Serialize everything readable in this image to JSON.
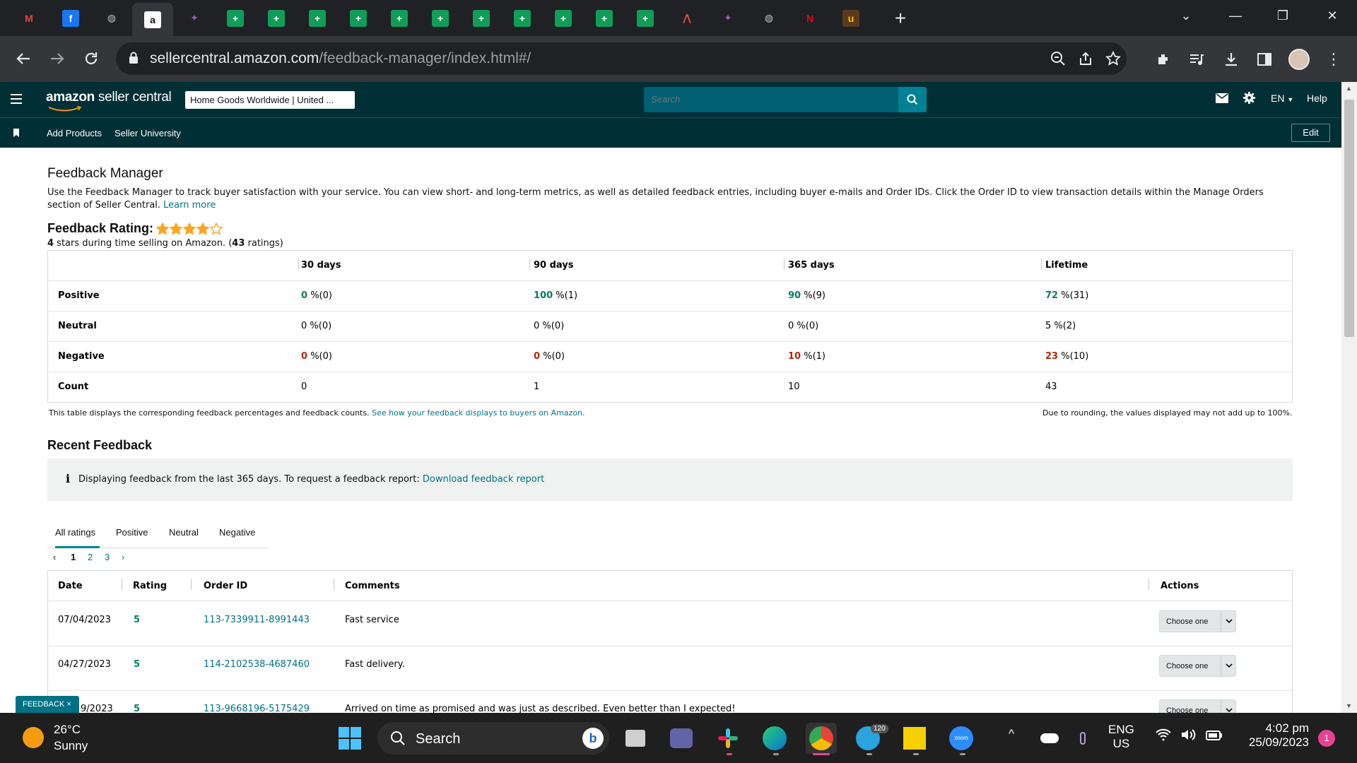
{
  "browser": {
    "url_host": "sellercentral.amazon.com",
    "url_path": "/feedback-manager/index.html#/",
    "tab_icons": [
      "gmail",
      "facebook",
      "globe",
      "amazon",
      "app",
      "sheets",
      "sheets",
      "sheets",
      "sheets",
      "sheets",
      "sheets",
      "sheets",
      "sheets",
      "sheets",
      "sheets",
      "sheets",
      "chart",
      "app",
      "globe",
      "netflix",
      "ups"
    ],
    "new_tab_label": "+"
  },
  "sc": {
    "logo_brand": "amazon",
    "logo_product": " seller central",
    "store": "Home Goods Worldwide | United ...",
    "search_placeholder": "Search",
    "language": "EN",
    "help": "Help",
    "nav_links": [
      "Add Products",
      "Seller University"
    ],
    "edit": "Edit"
  },
  "page": {
    "title": "Feedback Manager",
    "intro": "Use the Feedback Manager to track buyer satisfaction with your service. You can view short- and long-term metrics, as well as detailed feedback entries, including buyer e-mails and Order IDs. Click the Order ID to view transaction details within the Manage Orders section of Seller Central.",
    "learn_more": "Learn more",
    "rating_label": "Feedback Rating:",
    "rating_stars": 4,
    "rating_max": 5,
    "rating_value": "4",
    "rating_text_mid": " stars during time selling on Amazon. (",
    "rating_count": "43",
    "rating_text_end": " ratings)"
  },
  "metrics": {
    "headers": [
      "30 days",
      "90 days",
      "365 days",
      "Lifetime"
    ],
    "rows": [
      {
        "label": "Positive",
        "cells": [
          [
            "0",
            "%(0)"
          ],
          [
            "100",
            "%(1)"
          ],
          [
            "90",
            "%(9)"
          ],
          [
            "72",
            "%(31)"
          ]
        ],
        "tone": "green"
      },
      {
        "label": "Neutral",
        "cells": [
          [
            "0",
            "%(0)"
          ],
          [
            "0",
            "%(0)"
          ],
          [
            "0",
            "%(0)"
          ],
          [
            "5",
            "%(2)"
          ]
        ],
        "tone": "plain"
      },
      {
        "label": "Negative",
        "cells": [
          [
            "0",
            "%(0)"
          ],
          [
            "0",
            "%(0)"
          ],
          [
            "10",
            "%(1)"
          ],
          [
            "23",
            "%(10)"
          ]
        ],
        "tone": "red"
      },
      {
        "label": "Count",
        "cells": [
          [
            "0",
            ""
          ],
          [
            "1",
            ""
          ],
          [
            "10",
            ""
          ],
          [
            "43",
            ""
          ]
        ],
        "tone": "plain"
      }
    ],
    "note_left": "This table displays the corresponding feedback percentages and feedback counts.",
    "note_link": "See how your feedback displays to buyers on Amazon.",
    "note_right": "Due to rounding, the values displayed may not add up to 100%."
  },
  "recent": {
    "title": "Recent Feedback",
    "info_icon": "i",
    "info_text": "Displaying feedback from the last 365 days. To request a feedback report:",
    "info_link": "Download feedback report",
    "tabs": [
      "All ratings",
      "Positive",
      "Neutral",
      "Negative"
    ],
    "pages": [
      "1",
      "2",
      "3"
    ],
    "columns": [
      "Date",
      "Rating",
      "Order ID",
      "Comments",
      "Actions"
    ],
    "rows": [
      {
        "date": "07/04/2023",
        "rating": "5",
        "order": "113-7339911-8991443",
        "comment": "Fast service",
        "action": "Choose one"
      },
      {
        "date": "04/27/2023",
        "rating": "5",
        "order": "114-2102538-4687460",
        "comment": "Fast delivery.",
        "action": "Choose one"
      },
      {
        "date": "9/2023",
        "rating": "5",
        "order": "113-9668196-5175429",
        "comment": "Arrived on time as promised and was just as described. Even better than I expected!",
        "action": "Choose one"
      }
    ],
    "feedback_tag": "FEEDBACK ×"
  },
  "taskbar": {
    "temp": "26°C",
    "weather": "Sunny",
    "search": "Search",
    "telegram_badge": "120",
    "lang_top": "ENG",
    "lang_bottom": "US",
    "time": "4:02 pm",
    "date": "25/09/2023",
    "notif_count": "1"
  },
  "colors": {
    "sc_header": "#002f36",
    "link": "#007185",
    "positive": "#067d62",
    "negative": "#b12704",
    "star": "#ffa41c"
  }
}
